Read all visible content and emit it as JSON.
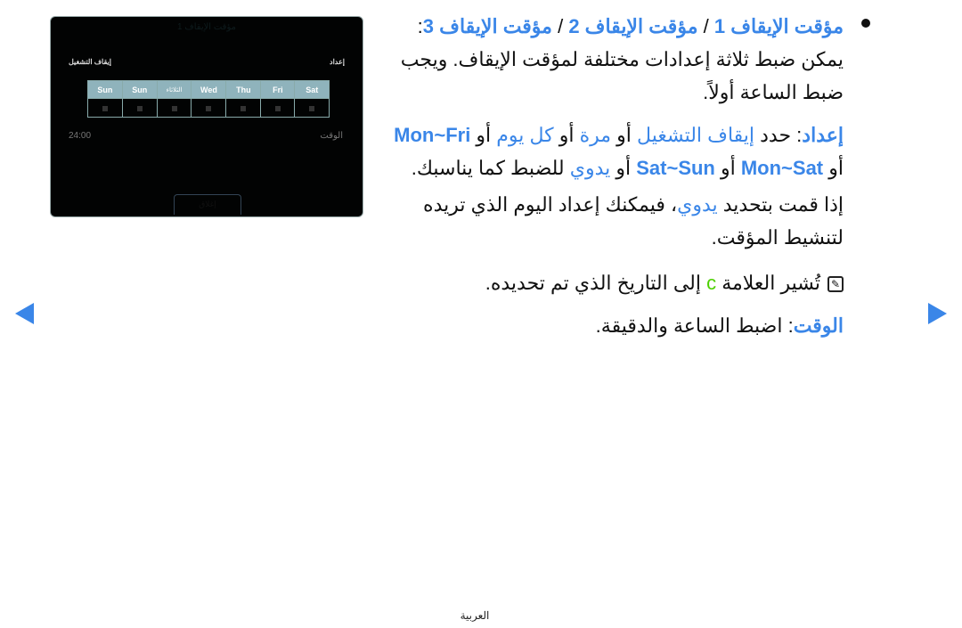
{
  "tv_screen": {
    "title": "مؤقت الإيقاف 1",
    "setup_label": "إعداد",
    "setup_value": "إيقاف التشغيل",
    "days": [
      "Sun",
      "Sun",
      "الثلاثاء",
      "Wed",
      "Thu",
      "Fri",
      "Sat"
    ],
    "time_label": "الوقت",
    "time_value": "24:00",
    "close_button": "إغلاق"
  },
  "content": {
    "p1": {
      "t1": "مؤقت الإيقاف 1",
      "sep1": " / ",
      "t2": "مؤقت الإيقاف 2",
      "sep2": " / ",
      "t3": "مؤقت الإيقاف 3",
      "rest": ": يمكن ضبط ثلاثة إعدادات مختلفة لمؤقت الإيقاف. ويجب ضبط الساعة أولاً."
    },
    "p2": {
      "k": "إعداد",
      "a": ": حدد ",
      "o1": "إيقاف التشغيل",
      "or1": " أو ",
      "o2": "مرة",
      "or2": " أو ",
      "o3": "كل يوم",
      "or3": " أو ",
      "o4": "Mon~Fri",
      "or4": " أو ",
      "o5": "Mon~Sat",
      "or5": " أو ",
      "o6": "Sat~Sun",
      "or6": " أو ",
      "o7": "يدوي",
      "end": " للضبط كما يناسبك."
    },
    "p3": {
      "a": "إذا قمت بتحديد ",
      "o": "يدوي",
      "b": "، فيمكنك إعداد اليوم الذي تريده لتنشيط المؤقت."
    },
    "note": {
      "a": "تُشير العلامة ",
      "mark": "c",
      "b": " إلى التاريخ الذي تم تحديده."
    },
    "p4": {
      "k": "الوقت",
      "rest": ": اضبط الساعة والدقيقة."
    }
  },
  "nav": {
    "prev_icon": "triangle-left-icon",
    "next_icon": "triangle-right-icon"
  },
  "footer": {
    "language": "العربية"
  },
  "colors": {
    "accent": "#3a86e8",
    "mark": "#4cd000"
  }
}
